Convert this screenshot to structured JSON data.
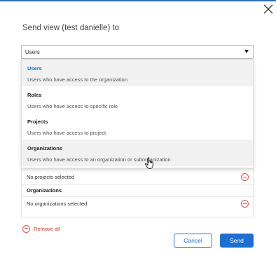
{
  "dialog": {
    "title": "Send view (test danielle) to"
  },
  "recipient_type_select": {
    "value": "Users",
    "options": [
      {
        "label": "Users",
        "description": "Users who have access to the organization"
      },
      {
        "label": "Roles",
        "description": "Users who have access to specific role"
      },
      {
        "label": "Projects",
        "description": "Users who have access to project"
      },
      {
        "label": "Organizations",
        "description": "Users who have access to an organization or suborganization"
      }
    ]
  },
  "selection_panel": {
    "projects_empty": "No projects selected",
    "organizations_heading": "Organizations",
    "organizations_empty": "No organizations selected"
  },
  "footer": {
    "remove_all_label": "Remove all",
    "cancel_label": "Cancel",
    "send_label": "Send"
  },
  "icons": {
    "close": "close-icon",
    "caret": "chevron-down-icon",
    "remove": "remove-circle-icon",
    "cursor": "hand-pointer-icon"
  },
  "colors": {
    "accent": "#1f6fd1",
    "selected_option": "#1f6fc4",
    "danger": "#d9534f"
  }
}
